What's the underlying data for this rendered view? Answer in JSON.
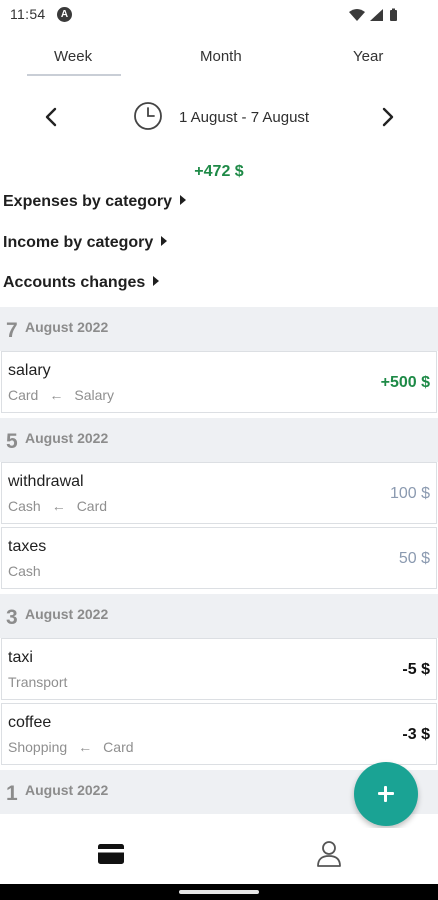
{
  "status": {
    "time": "11:54",
    "badge": "A"
  },
  "tabs": [
    {
      "label": "Week",
      "selected": true
    },
    {
      "label": "Month",
      "selected": false
    },
    {
      "label": "Year",
      "selected": false
    }
  ],
  "date_range": "1 August - 7 August",
  "total": "+472 $",
  "sections": {
    "expenses": "Expenses by category",
    "income": "Income by category",
    "accounts": "Accounts changes"
  },
  "days": [
    {
      "day": "7",
      "month": "August 2022",
      "transactions": [
        {
          "name": "salary",
          "from": "Card",
          "arrow": "←",
          "to": "Salary",
          "amount": "+500 $"
        }
      ]
    },
    {
      "day": "5",
      "month": "August 2022",
      "transactions": [
        {
          "name": "withdrawal",
          "from": "Cash",
          "arrow": "←",
          "to": "Card",
          "amount": "100 $"
        },
        {
          "name": "taxes",
          "from": "Cash",
          "amount": "50 $"
        }
      ]
    },
    {
      "day": "3",
      "month": "August 2022",
      "transactions": [
        {
          "name": "taxi",
          "from": "Transport",
          "amount": "-5 $"
        },
        {
          "name": "coffee",
          "from": "Shopping",
          "arrow": "←",
          "to": "Card",
          "amount": "-3 $"
        }
      ]
    },
    {
      "day": "1",
      "month": "August 2022"
    }
  ],
  "colors": {
    "accent": "#1aa394",
    "positive": "#1e8a47",
    "transfer": "#8b9ab0"
  },
  "icons": {
    "fab": "plus-icon",
    "nav_left": "card-icon",
    "nav_right": "person-icon"
  }
}
